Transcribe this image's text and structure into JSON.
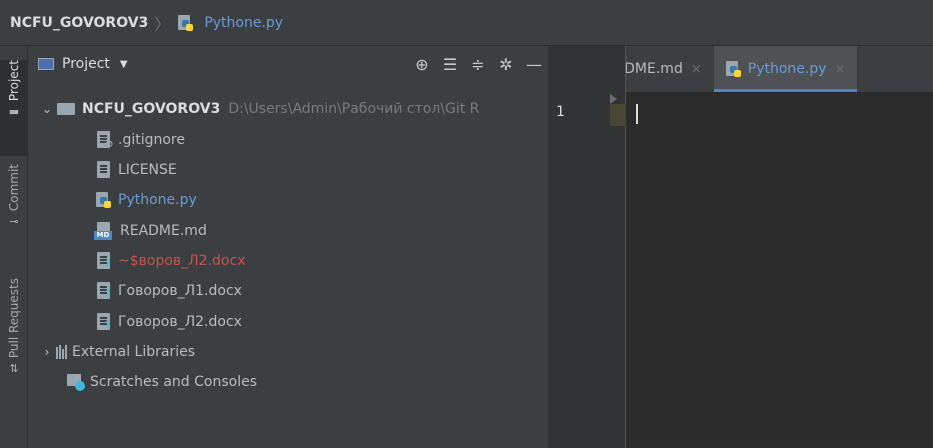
{
  "breadcrumb": {
    "project": "NCFU_GOVOROV3",
    "separator": "〉",
    "file": "Pythone.py"
  },
  "tool_strip": {
    "project_tab": "Project",
    "commit_tab": "Commit",
    "pull_requests_tab": "Pull Requests"
  },
  "project_panel": {
    "title": "Project",
    "icons": [
      "locate-icon",
      "expand-all-icon",
      "collapse-all-icon",
      "gear-icon",
      "minimize-icon"
    ]
  },
  "tree": {
    "root": {
      "name": "NCFU_GOVOROV3",
      "path": "D:\\Users\\Admin\\Рабочий стол\\Git R"
    },
    "files": [
      {
        "name": ".gitignore",
        "status": "ignored"
      },
      {
        "name": "LICENSE",
        "status": "normal"
      },
      {
        "name": "Pythone.py",
        "status": "added"
      },
      {
        "name": "README.md",
        "status": "normal"
      },
      {
        "name": "~$воров_Л2.docx",
        "status": "unversioned-red"
      },
      {
        "name": "Говоров_Л1.docx",
        "status": "unversioned"
      },
      {
        "name": "Говоров_Л2.docx",
        "status": "unversioned"
      }
    ],
    "external_libraries": "External Libraries",
    "scratches": "Scratches and Consoles"
  },
  "tabs": [
    {
      "label": "README.md",
      "close": "×",
      "active": false
    },
    {
      "label": "Pythone.py",
      "close": "×",
      "active": true
    }
  ],
  "editor": {
    "line_number": "1"
  },
  "colors": {
    "accent": "#4a88c7",
    "added_file": "#6a9bd8",
    "unversioned_red": "#c75450"
  }
}
